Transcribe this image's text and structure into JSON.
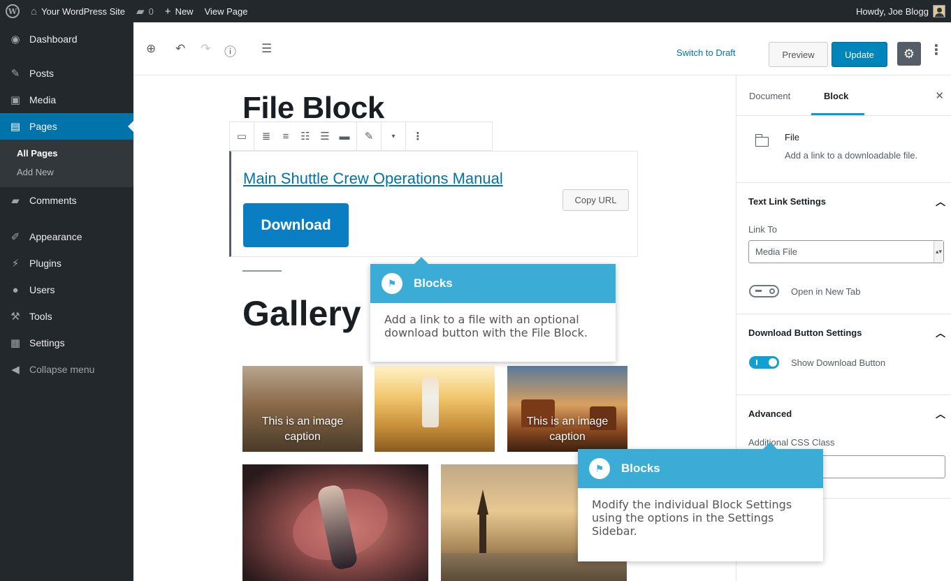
{
  "admin_bar": {
    "site_name": "Your WordPress Site",
    "comments_count": "0",
    "new_label": "New",
    "view_page_label": "View Page",
    "greeting": "Howdy, Joe Blogg"
  },
  "sidebar": {
    "items": [
      {
        "label": "Dashboard",
        "icon": "dashboard-icon"
      },
      {
        "label": "Posts",
        "icon": "pin-icon"
      },
      {
        "label": "Media",
        "icon": "media-icon"
      },
      {
        "label": "Pages",
        "icon": "pages-icon"
      },
      {
        "label": "Comments",
        "icon": "comment-icon"
      },
      {
        "label": "Appearance",
        "icon": "brush-icon"
      },
      {
        "label": "Plugins",
        "icon": "plugin-icon"
      },
      {
        "label": "Users",
        "icon": "users-icon"
      },
      {
        "label": "Tools",
        "icon": "wrench-icon"
      },
      {
        "label": "Settings",
        "icon": "settings-icon"
      },
      {
        "label": "Collapse menu",
        "icon": "collapse-icon"
      }
    ],
    "submenu": [
      "All Pages",
      "Add New"
    ]
  },
  "editor_header": {
    "switch_to_draft": "Switch to Draft",
    "preview": "Preview",
    "update": "Update"
  },
  "content": {
    "file_heading": "File Block",
    "file_link_text": "Main Shuttle Crew Operations Manual",
    "copy_url": "Copy URL",
    "download_label": "Download",
    "gallery_heading": "Gallery",
    "captions": [
      "This is an image caption",
      "This is an image caption"
    ]
  },
  "tooltips": [
    {
      "title": "Blocks",
      "body": "Add a link to a file with an optional download button with the File Block."
    },
    {
      "title": "Blocks",
      "body": "Modify the individual Block Settings using the options in the Settings Sidebar."
    }
  ],
  "settings_sidebar": {
    "tabs": [
      "Document",
      "Block"
    ],
    "block_name": "File",
    "block_description": "Add a link to a downloadable file.",
    "text_link_settings": {
      "title": "Text Link Settings",
      "link_to_label": "Link To",
      "link_to_value": "Media File",
      "open_new_tab_label": "Open in New Tab",
      "open_new_tab": false
    },
    "download_button_settings": {
      "title": "Download Button Settings",
      "show_download_button_label": "Show Download Button",
      "show_download_button": true
    },
    "advanced": {
      "title": "Advanced",
      "css_class_label": "Additional CSS Class",
      "css_class_value": ""
    }
  },
  "colors": {
    "admin_dark": "#23282d",
    "active_blue": "#0073aa",
    "update_blue": "#0085ba",
    "tooltip_blue": "#3aacd6"
  }
}
